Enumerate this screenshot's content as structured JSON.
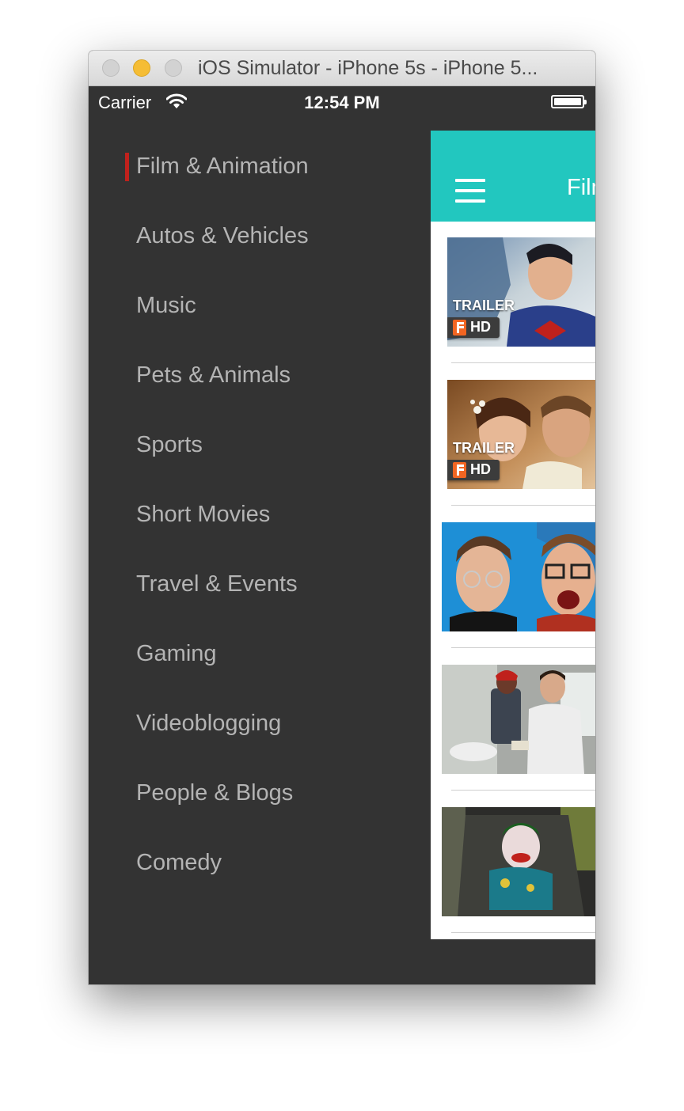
{
  "window": {
    "title": "iOS Simulator - iPhone 5s - iPhone 5..."
  },
  "status_bar": {
    "carrier": "Carrier",
    "time": "12:54 PM"
  },
  "menu": {
    "active_index": 0,
    "accent_color": "#c0211c",
    "items": [
      {
        "label": "Film & Animation"
      },
      {
        "label": "Autos & Vehicles"
      },
      {
        "label": "Music"
      },
      {
        "label": "Pets & Animals"
      },
      {
        "label": "Sports"
      },
      {
        "label": "Short Movies"
      },
      {
        "label": "Travel & Events"
      },
      {
        "label": "Gaming"
      },
      {
        "label": "Videoblogging"
      },
      {
        "label": "People & Blogs"
      },
      {
        "label": "Comedy"
      }
    ]
  },
  "content": {
    "navbar_color": "#22c7bf",
    "title": "Film & Animation",
    "videos": [
      {
        "badge_top": "TRAILER",
        "badge_bottom": "HD"
      },
      {
        "badge_top": "TRAILER",
        "badge_bottom": "HD"
      },
      {},
      {},
      {}
    ]
  }
}
